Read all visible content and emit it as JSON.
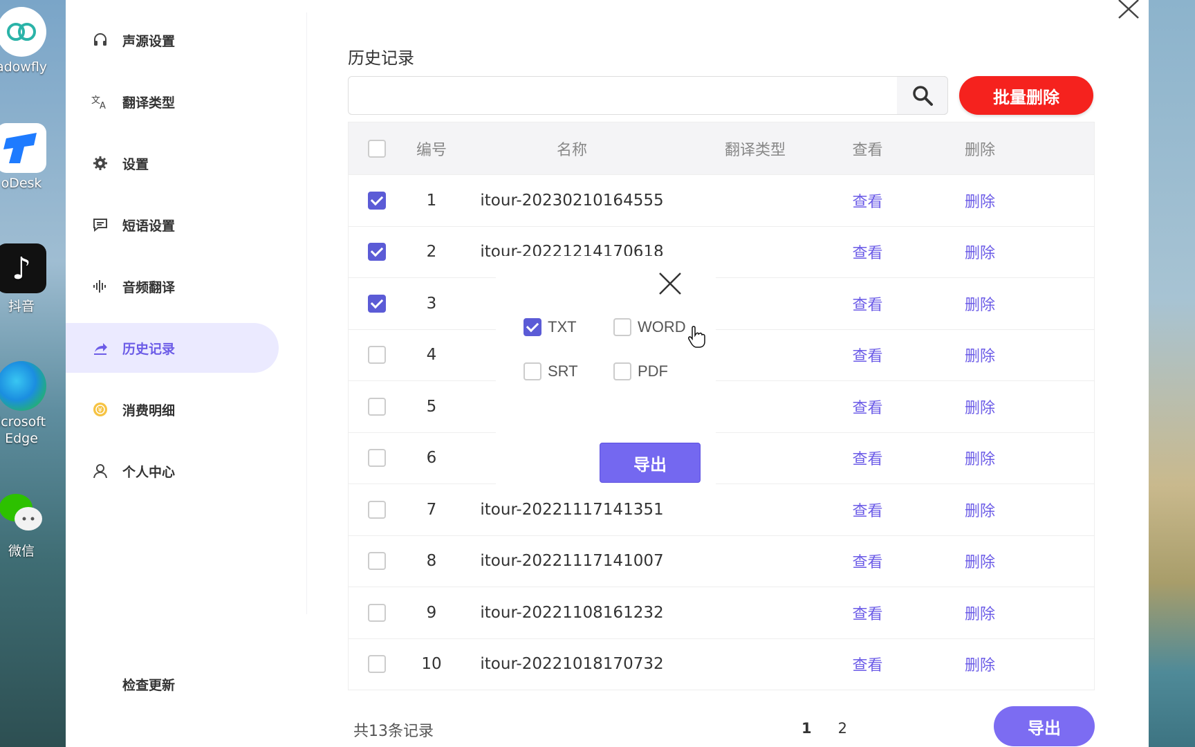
{
  "desktop": {
    "icons": [
      {
        "label": "adowfly"
      },
      {
        "label": "oDesk"
      },
      {
        "label": "抖音"
      },
      {
        "label": "icrosoft Edge"
      },
      {
        "label": "微信"
      }
    ]
  },
  "sidebar": {
    "items": [
      {
        "label": "声源设置"
      },
      {
        "label": "翻译类型"
      },
      {
        "label": "设置"
      },
      {
        "label": "短语设置"
      },
      {
        "label": "音频翻译"
      },
      {
        "label": "历史记录"
      },
      {
        "label": "消费明细"
      },
      {
        "label": "个人中心"
      }
    ],
    "active_index": 5,
    "check_update": "检查更新"
  },
  "main": {
    "title": "历史记录",
    "search": {
      "value": "",
      "placeholder": ""
    },
    "batch_delete": "批量删除",
    "table": {
      "headers": {
        "num": "编号",
        "name": "名称",
        "type": "翻译类型",
        "view": "查看",
        "delete": "删除"
      },
      "rows": [
        {
          "num": "1",
          "name": "itour-20230210164555",
          "type": "",
          "view": "查看",
          "delete": "删除",
          "checked": true
        },
        {
          "num": "2",
          "name": "itour-20221214170618",
          "type": "",
          "view": "查看",
          "delete": "删除",
          "checked": true
        },
        {
          "num": "3",
          "name": "",
          "type": "",
          "view": "查看",
          "delete": "删除",
          "checked": true
        },
        {
          "num": "4",
          "name": "",
          "type": "",
          "view": "查看",
          "delete": "删除",
          "checked": false
        },
        {
          "num": "5",
          "name": "",
          "type": "",
          "view": "查看",
          "delete": "删除",
          "checked": false
        },
        {
          "num": "6",
          "name": "",
          "type": "",
          "view": "查看",
          "delete": "删除",
          "checked": false
        },
        {
          "num": "7",
          "name": "itour-20221117141351",
          "type": "",
          "view": "查看",
          "delete": "删除",
          "checked": false
        },
        {
          "num": "8",
          "name": "itour-20221117141007",
          "type": "",
          "view": "查看",
          "delete": "删除",
          "checked": false
        },
        {
          "num": "9",
          "name": "itour-20221108161232",
          "type": "",
          "view": "查看",
          "delete": "删除",
          "checked": false
        },
        {
          "num": "10",
          "name": "itour-20221018170732",
          "type": "",
          "view": "查看",
          "delete": "删除",
          "checked": false
        }
      ]
    },
    "total": "共13条记录",
    "pages": [
      "1",
      "2"
    ],
    "current_page": "1",
    "export": "导出"
  },
  "dialog": {
    "options": [
      {
        "label": "TXT",
        "checked": true
      },
      {
        "label": "WORD",
        "checked": false
      },
      {
        "label": "SRT",
        "checked": false
      },
      {
        "label": "PDF",
        "checked": false
      }
    ],
    "export": "导出"
  },
  "colors": {
    "accent": "#6c5ce7",
    "danger": "#f5221e",
    "export": "#7c6cf2"
  }
}
